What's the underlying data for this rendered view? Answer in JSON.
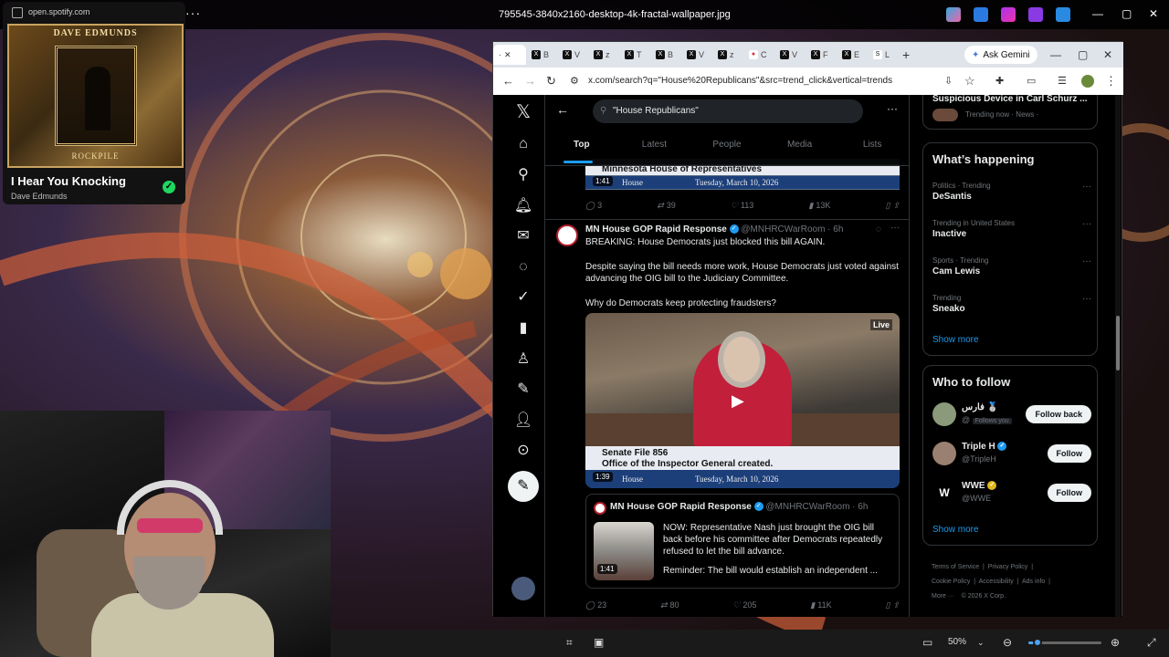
{
  "colors": {
    "x_blue": "#1d9bf0",
    "spotify_green": "#1ed760",
    "x_bg": "#000000",
    "muted": "#71767b"
  },
  "photo_viewer": {
    "filename": "795545-3840x2160-desktop-4k-fractal-wallpaper.jpg",
    "zoom": "50%",
    "zoom_level": 0.12
  },
  "spotify": {
    "url": "open.spotify.com",
    "album_art_title": "DAVE EDMUNDS",
    "album_art_subtitle": "ROCKPILE",
    "track": "I Hear You Knocking",
    "artist": "Dave Edmunds"
  },
  "browser": {
    "address": "x.com/search?q=\"House%20Republicans\"&src=trend_click&vertical=trends",
    "gemini": "Ask Gemini",
    "tabs": [
      {
        "icon": "x-icon",
        "label": "B"
      },
      {
        "icon": "x-icon",
        "label": "V"
      },
      {
        "icon": "x-icon",
        "label": "z"
      },
      {
        "icon": "x-icon",
        "label": "T"
      },
      {
        "icon": "x-icon",
        "label": "B"
      },
      {
        "icon": "x-icon",
        "label": "V"
      },
      {
        "icon": "x-icon",
        "label": "z"
      },
      {
        "icon": "red-icon",
        "label": "C"
      },
      {
        "icon": "x-icon",
        "label": "V"
      },
      {
        "icon": "x-icon",
        "label": "F"
      },
      {
        "icon": "x-icon",
        "label": "E"
      },
      {
        "icon": "s-icon",
        "label": "L"
      }
    ]
  },
  "search": {
    "query": "\"House Republicans\"",
    "tabs": [
      "Top",
      "Latest",
      "People",
      "Media",
      "Lists"
    ]
  },
  "tweet1": {
    "video_banner": "Minnesota House of Representatives",
    "video_org": "House",
    "video_date": "Tuesday, March 10, 2026",
    "duration": "1:41",
    "replies": "3",
    "reposts": "39",
    "likes": "113",
    "views": "13K"
  },
  "tweet2": {
    "name": "MN House GOP Rapid Response",
    "handle": "@MNHRCWarRoom · 6h",
    "line1": "BREAKING: House Democrats just blocked this bill AGAIN.",
    "line2": "Despite saying the bill needs more work, House Democrats just voted against advancing the OIG bill to the Judiciary Committee.",
    "line3": "Why do Democrats keep protecting fraudsters?",
    "video_live": "Live",
    "caption1": "Senate File 856",
    "caption2": "Office of the Inspector General created.",
    "video_org": "House",
    "video_date": "Tuesday, March 10, 2026",
    "duration": "1:39",
    "quote": {
      "name": "MN House GOP Rapid Response",
      "handle": "@MNHRCWarRoom · 6h",
      "text1": "NOW: Representative Nash just brought the OIG bill back before his committee after Democrats repeatedly refused to let the bill advance.",
      "text2": "Reminder: The bill would establish an independent ...",
      "duration": "1:41"
    },
    "replies": "23",
    "reposts": "80",
    "likes": "205",
    "views": "11K"
  },
  "sidebar": {
    "top_trend": {
      "name": "Suspicious Device in Carl Schurz ...",
      "meta": "Trending now · News ·"
    },
    "happening_title": "What’s happening",
    "trends": [
      {
        "context": "Politics · Trending",
        "name": "DeSantis"
      },
      {
        "context": "Trending in United States",
        "name": "Inactive"
      },
      {
        "context": "Sports · Trending",
        "name": "Cam Lewis"
      },
      {
        "context": "Trending",
        "name": "Sneako"
      }
    ],
    "show_more": "Show more",
    "who_title": "Who to follow",
    "follow": [
      {
        "name": "فارس 🥈",
        "handle": "@",
        "badge": "Follows you",
        "button": "Follow back"
      },
      {
        "name": "Triple H",
        "handle": "@TripleH",
        "button": "Follow"
      },
      {
        "name": "WWE",
        "handle": "@WWE",
        "button": "Follow"
      }
    ],
    "show_more2": "Show more",
    "footer": [
      "Terms of Service",
      "Privacy Policy",
      "Cookie Policy",
      "Accessibility",
      "Ads info",
      "More ···",
      "© 2026 X Corp."
    ]
  }
}
